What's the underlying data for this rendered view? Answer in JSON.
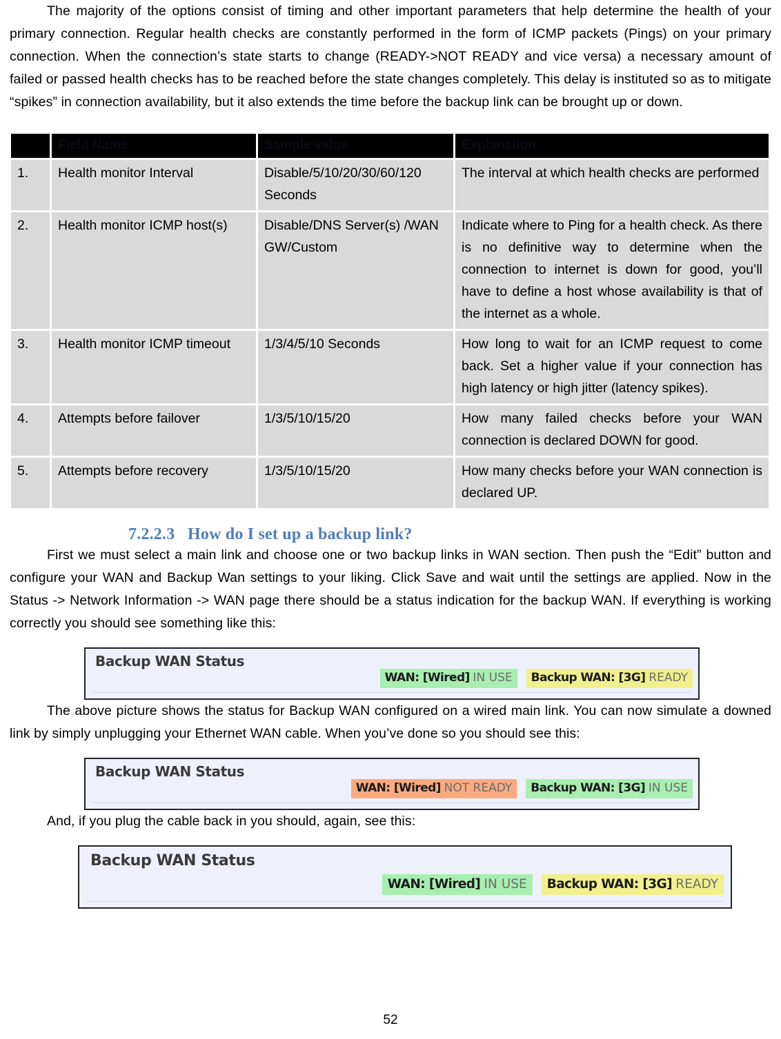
{
  "document": {
    "page_number": "52",
    "intro_paragraph": "The majority of the options consist of timing and other important parameters that help determine the health of your primary connection. Regular health checks are constantly performed in the form of ICMP packets (Pings) on your primary connection. When the connection’s state starts to change (READY->NOT READY and vice versa) a necessary amount of failed or passed health checks has to be reached before the state changes completely. This delay is instituted so as to mitigate “spikes” in connection availability, but it also extends the time before the backup link can be brought up or down."
  },
  "table": {
    "headers": {
      "num": "",
      "field_name": "Field Name",
      "sample_value": "Sample value",
      "explanation": "Explanation"
    },
    "rows": [
      {
        "num": "1.",
        "field": "Health monitor Interval",
        "value": "Disable/5/10/20/30/60/120 Seconds",
        "explanation": "The interval at which health checks are performed"
      },
      {
        "num": "2.",
        "field": "Health monitor ICMP host(s)",
        "value": "Disable/DNS Server(s) /WAN GW/Custom",
        "explanation": "Indicate where to Ping for a health check. As there is no definitive way to determine when the connection to internet is down for good, you’ll have to define a host whose availability is that of the internet as a whole."
      },
      {
        "num": "3.",
        "field": "Health monitor ICMP timeout",
        "value": "1/3/4/5/10 Seconds",
        "explanation": "How long to wait for an ICMP request to come back. Set a higher value if your connection has high latency or high jitter (latency spikes)."
      },
      {
        "num": "4.",
        "field": "Attempts before failover",
        "value": "1/3/5/10/15/20",
        "explanation": "How many failed checks before your WAN connection is declared DOWN for good."
      },
      {
        "num": "5.",
        "field": "Attempts before recovery",
        "value": "1/3/5/10/15/20",
        "explanation": "How many checks before your WAN connection is declared UP."
      }
    ]
  },
  "section": {
    "number": "7.2.2.3",
    "title": "How do I set up a backup link?",
    "color": "#4f7dba"
  },
  "paragraphs": {
    "howto": "First we must select a main link and choose one or two backup links in WAN section. Then push the “Edit” button and configure your WAN and Backup Wan settings to your liking. Click Save and wait until the settings are applied. Now in the Status -> Network Information -> WAN page there should be a status indication for the backup WAN. If everything is working correctly you should see something like this:",
    "above_picture": "The above picture shows the status for Backup WAN configured on a wired main link. You can now simulate a downed link by simply unplugging your Ethernet WAN cable. When you’ve done so you should see this:",
    "plug_back": "And, if you plug the cable back in you should, again, see this:"
  },
  "widgets": [
    {
      "title": "Backup WAN Status",
      "badges": [
        {
          "label": "WAN: [Wired]",
          "state": "IN USE",
          "color": "#a8eeb0",
          "tone": "green"
        },
        {
          "label": "Backup WAN: [3G]",
          "state": "READY",
          "color": "#f0f08c",
          "tone": "yellow"
        }
      ]
    },
    {
      "title": "Backup WAN Status",
      "badges": [
        {
          "label": "WAN: [Wired]",
          "state": "NOT READY",
          "color": "#fbaa7e",
          "tone": "orange"
        },
        {
          "label": "Backup WAN: [3G]",
          "state": "IN USE",
          "color": "#a8eeb0",
          "tone": "green"
        }
      ]
    },
    {
      "title": "Backup WAN Status",
      "badges": [
        {
          "label": "WAN: [Wired]",
          "state": "IN USE",
          "color": "#a8eeb0",
          "tone": "green"
        },
        {
          "label": "Backup WAN: [3G]",
          "state": "READY",
          "color": "#f0f08c",
          "tone": "yellow"
        }
      ]
    }
  ]
}
